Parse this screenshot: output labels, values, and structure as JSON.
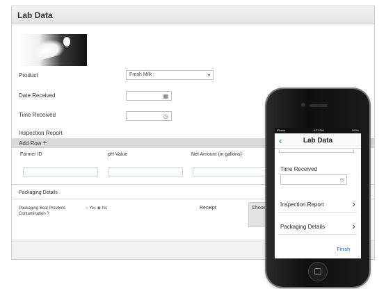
{
  "form": {
    "title": "Lab Data",
    "product_label": "Product",
    "product_value": "Fresh Milk",
    "date_received_label": "Date Received",
    "time_received_label": "Time Received",
    "inspection_report_label": "Inspection Report",
    "add_row_label": "Add Row",
    "columns": [
      "Farmer ID",
      "pH Value",
      "Net Amount (in gallons)"
    ],
    "packaging_details_label": "Packaging Details",
    "packaging_question": "Packaging Seal Prevents Contamination ?",
    "radio_options": [
      "Yes",
      "No"
    ],
    "radio_selected": "No",
    "receipt_label": "Receipt",
    "choose_button_label": "Choose"
  },
  "mobile": {
    "status_carrier": "iPhone",
    "status_time": "4:21 PM",
    "status_battery": "100%",
    "title": "Lab Data",
    "time_received_label": "Time Received",
    "rows": [
      "Inspection Report",
      "Packaging Details"
    ],
    "finish_label": "Finish"
  },
  "icons": {
    "calendar": "calendar-icon",
    "clock": "clock-icon",
    "back": "back-chevron-icon",
    "row_chevron": "chevron-right-icon"
  },
  "colors": {
    "accent_blue": "#1a63c6",
    "bar_gray": "#d9d9d9"
  }
}
